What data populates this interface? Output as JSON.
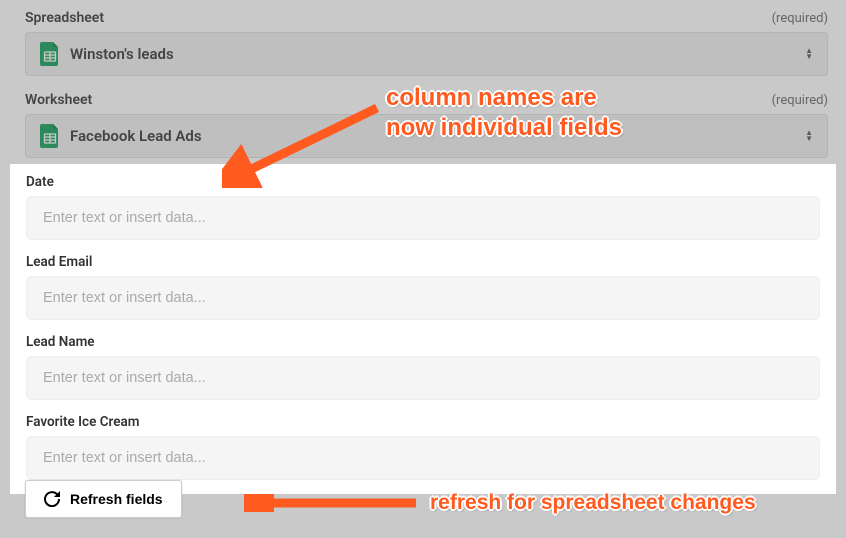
{
  "spreadsheet": {
    "label": "Spreadsheet",
    "required_text": "(required)",
    "value": "Winston's leads"
  },
  "worksheet": {
    "label": "Worksheet",
    "required_text": "(required)",
    "value": "Facebook Lead Ads"
  },
  "fields": [
    {
      "label": "Date",
      "placeholder": "Enter text or insert data..."
    },
    {
      "label": "Lead Email",
      "placeholder": "Enter text or insert data..."
    },
    {
      "label": "Lead Name",
      "placeholder": "Enter text or insert data..."
    },
    {
      "label": "Favorite Ice Cream",
      "placeholder": "Enter text or insert data..."
    }
  ],
  "refresh_button_label": "Refresh fields",
  "annotations": {
    "top_line1": "column names are",
    "top_line2": "now individual fields",
    "bottom": "refresh for spreadsheet changes"
  }
}
